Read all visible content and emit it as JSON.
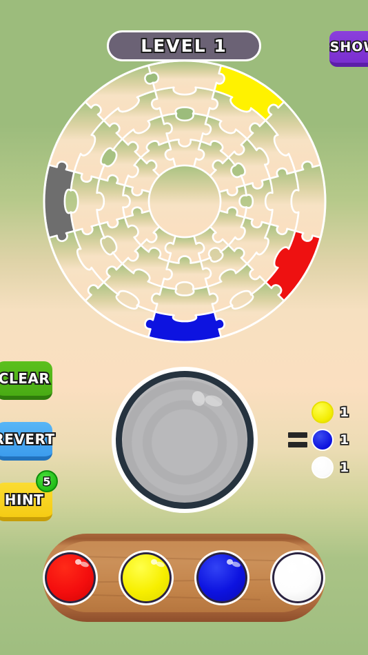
{
  "header": {
    "level_label": "LEVEL 1",
    "show_button_label": "SHOW"
  },
  "colors": {
    "background_top": "#9cbc7c",
    "background_mid": "#fbdfc0",
    "background_bottom": "#9fbe80",
    "banner_fill": "#6b6275",
    "show_button": "#7f35d6",
    "clear_button": "#52b618",
    "revert_button": "#46a3f0",
    "hint_button": "#f8d41f",
    "badge_green": "#23bf18",
    "tray_wood": "#c4874f",
    "bowl_gray": "#b9b9bb",
    "bowl_rim": "#26333f"
  },
  "actions": [
    {
      "id": "clear",
      "label": "CLEAR"
    },
    {
      "id": "revert",
      "label": "REVERT"
    },
    {
      "id": "hint",
      "label": "HINT",
      "badge": "5"
    }
  ],
  "puzzle": {
    "rings": 4,
    "sectors": 12,
    "center_hub": true,
    "piece_line_color": "#ffffff",
    "filled_pieces": [
      {
        "color_name": "yellow",
        "color": "#fff200",
        "ring": 3,
        "sector": 1
      },
      {
        "color_name": "red",
        "color": "#ee1111",
        "ring": 3,
        "sector": 4
      },
      {
        "color_name": "gray",
        "color": "#6e6e6e",
        "ring": 3,
        "sector": 9
      },
      {
        "color_name": "blue",
        "color": "#0d13e0",
        "ring": 3,
        "sector": 6
      }
    ]
  },
  "mixing_bowl": {
    "state_label": "empty",
    "fill_color": "#b9b9bb"
  },
  "recipe": {
    "equals_symbol": "=",
    "items": [
      {
        "color_name": "yellow",
        "color": "#f2ec00",
        "count": "1"
      },
      {
        "color_name": "blue",
        "color": "#0c11de",
        "count": "1"
      },
      {
        "color_name": "white",
        "color": "#ffffff",
        "count": "1"
      }
    ]
  },
  "palette": {
    "balls": [
      {
        "color_name": "red",
        "color": "#f40e0e"
      },
      {
        "color_name": "yellow",
        "color": "#f7ef00"
      },
      {
        "color_name": "blue",
        "color": "#0d13e0"
      },
      {
        "color_name": "white",
        "color": "#ffffff"
      }
    ]
  }
}
